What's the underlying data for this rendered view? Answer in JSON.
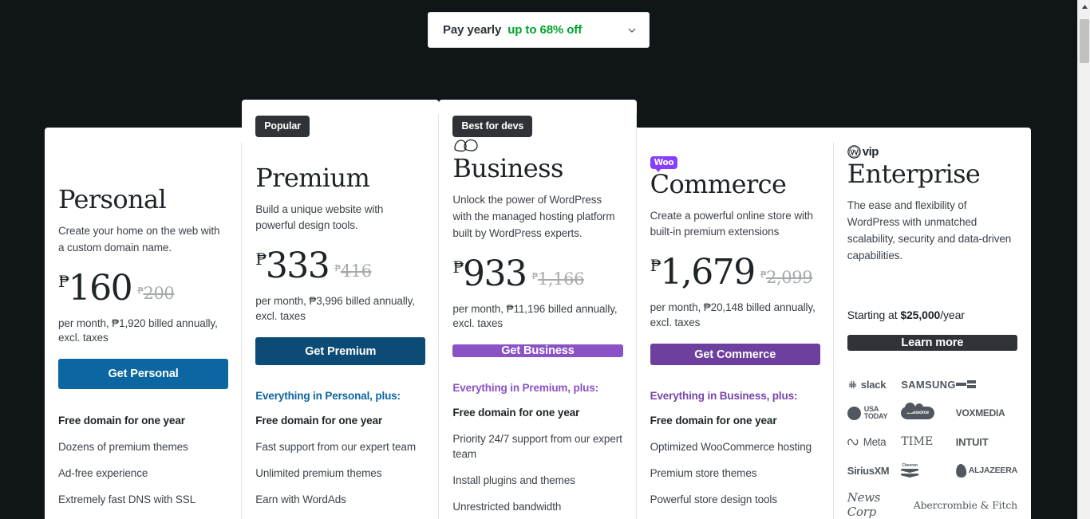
{
  "billing": {
    "label": "Pay yearly",
    "discount": "up to 68% off",
    "caret_icon": "chevron-down-icon"
  },
  "plans": [
    {
      "id": "personal",
      "badge": null,
      "logo": null,
      "name": "Personal",
      "description": "Create your home on the web with a custom domain name.",
      "currency": "₱",
      "price": "160",
      "old_price": "200",
      "price_note": "per month, ₱1,920 billed annually, excl. taxes",
      "cta": "Get Personal",
      "cta_color": "#0b66a2",
      "features_head": null,
      "features_head_color": null,
      "features": [
        {
          "text": "Free domain for one year",
          "bold": true
        },
        {
          "text": "Dozens of premium themes",
          "bold": false
        },
        {
          "text": "Ad-free experience",
          "bold": false
        },
        {
          "text": "Extremely fast DNS with SSL",
          "bold": false
        }
      ]
    },
    {
      "id": "premium",
      "badge": "Popular",
      "logo": null,
      "name": "Premium",
      "description": "Build a unique website with powerful design tools.",
      "currency": "₱",
      "price": "333",
      "old_price": "416",
      "price_note": "per month, ₱3,996 billed annually, excl. taxes",
      "cta": "Get Premium",
      "cta_color": "#0b4b75",
      "features_head": "Everything in Personal, plus:",
      "features_head_color": "#0b66a2",
      "features": [
        {
          "text": "Free domain for one year",
          "bold": true
        },
        {
          "text": "Fast support from our expert team",
          "bold": false
        },
        {
          "text": "Unlimited premium themes",
          "bold": false
        },
        {
          "text": "Earn with WordAds",
          "bold": false
        }
      ]
    },
    {
      "id": "business",
      "badge": "Best for devs",
      "logo": "wp-cloud-icon",
      "name": "Business",
      "description": "Unlock the power of WordPress with the managed hosting platform built by WordPress experts.",
      "currency": "₱",
      "price": "933",
      "old_price": "1,166",
      "price_note": "per month, ₱11,196 billed annually, excl. taxes",
      "cta": "Get Business",
      "cta_color": "#8b52c6",
      "features_head": "Everything in Premium, plus:",
      "features_head_color": "#8b52c6",
      "features": [
        {
          "text": "Free domain for one year",
          "bold": true
        },
        {
          "text": "Priority 24/7 support from our expert team",
          "bold": false
        },
        {
          "text": "Install plugins and themes",
          "bold": false
        },
        {
          "text": "Unrestricted bandwidth",
          "bold": false
        }
      ]
    },
    {
      "id": "commerce",
      "badge": null,
      "logo": "woo-icon",
      "logo_text": "Woo",
      "name": "Commerce",
      "description": "Create a powerful online store with built-in premium extensions",
      "currency": "₱",
      "price": "1,679",
      "old_price": "2,099",
      "price_note": "per month, ₱20,148 billed annually, excl. taxes",
      "cta": "Get Commerce",
      "cta_color": "#6d3f9e",
      "features_head": "Everything in Business, plus:",
      "features_head_color": "#7845ad",
      "features": [
        {
          "text": "Free domain for one year",
          "bold": true
        },
        {
          "text": "Optimized WooCommerce hosting",
          "bold": false
        },
        {
          "text": "Premium store themes",
          "bold": false
        },
        {
          "text": "Powerful store design tools",
          "bold": false
        }
      ]
    },
    {
      "id": "enterprise",
      "badge": null,
      "logo": "wordpress-vip-icon",
      "logo_text": "vip",
      "name": "Enterprise",
      "description": "The ease and flexibility of WordPress with unmatched scalability, security and data-driven capabilities.",
      "starting_at_prefix": "Starting at ",
      "starting_at_price": "$25,000",
      "starting_at_suffix": "/year",
      "cta": "Learn more",
      "cta_color": "#2f3337",
      "logos": [
        "slack",
        "SAMSUNG",
        "TC",
        "USA TODAY",
        "salesforce",
        "VOXMEDIA",
        "Meta",
        "TIME",
        "INTUIT",
        "SiriusXM",
        "Chevron",
        "ALJAZEERA",
        "News Corp",
        "Abercrombie & Fitch"
      ]
    }
  ]
}
